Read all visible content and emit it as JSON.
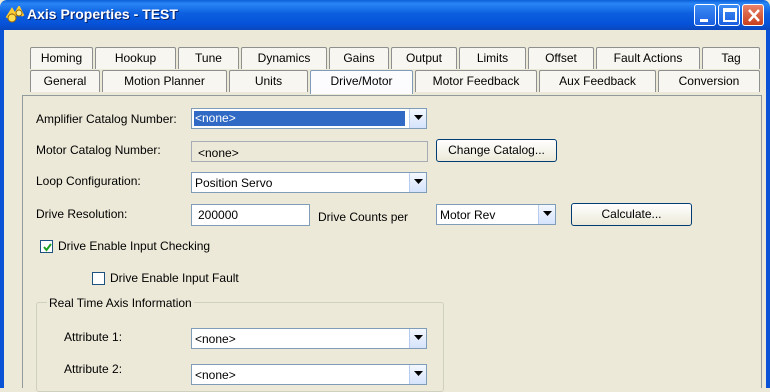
{
  "window": {
    "title": "Axis Properties - TEST",
    "colors": {
      "titlebar": "#0a5fd8",
      "close_button": "#c8401c",
      "selection": "#316ac5",
      "panel": "#ece9d8"
    }
  },
  "tabs": {
    "row1": [
      "Homing",
      "Hookup",
      "Tune",
      "Dynamics",
      "Gains",
      "Output",
      "Limits",
      "Offset",
      "Fault Actions",
      "Tag"
    ],
    "row2": [
      "General",
      "Motion Planner",
      "Units",
      "Drive/Motor",
      "Motor Feedback",
      "Aux Feedback",
      "Conversion"
    ],
    "active": "Drive/Motor"
  },
  "form": {
    "amplifier_catalog": {
      "label": "Amplifier Catalog Number:",
      "value": "<none>"
    },
    "motor_catalog": {
      "label": "Motor Catalog Number:",
      "value": "<none>",
      "button": "Change Catalog..."
    },
    "loop_configuration": {
      "label": "Loop Configuration:",
      "value": "Position Servo"
    },
    "drive_resolution": {
      "label": "Drive Resolution:",
      "value": "200000",
      "counts_label": "Drive Counts per",
      "unit": "Motor Rev",
      "button": "Calculate..."
    },
    "drive_enable_input_checking": {
      "label": "Drive Enable Input Checking",
      "checked": true
    },
    "drive_enable_input_fault": {
      "label": "Drive Enable Input Fault",
      "checked": false
    },
    "realtime_group": {
      "title": "Real Time Axis Information",
      "attribute1": {
        "label": "Attribute 1:",
        "value": "<none>"
      },
      "attribute2": {
        "label": "Attribute 2:",
        "value": "<none>"
      }
    }
  }
}
